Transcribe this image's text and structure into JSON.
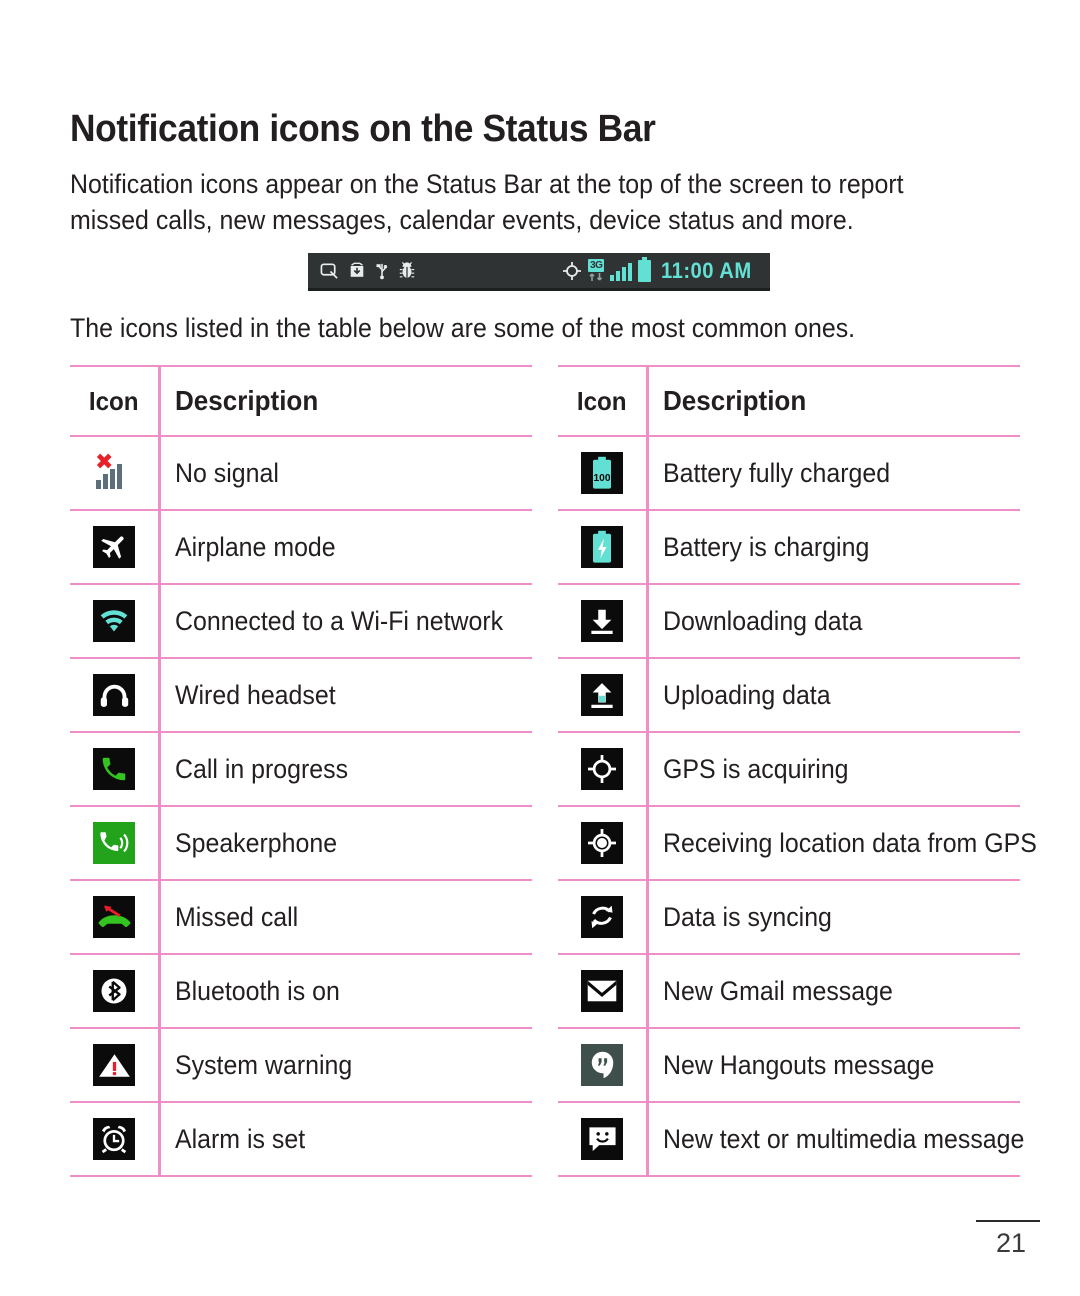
{
  "page": {
    "title": "Notification icons on the Status Bar",
    "intro": "Notification icons appear on the Status Bar at the top of the screen to report missed calls, new messages, calendar events, device status and more.",
    "note": "The icons listed in the table below are some of the most common ones.",
    "page_number": "21"
  },
  "status_bar": {
    "time": "11:00 AM",
    "network_label": "3G",
    "left_icons": [
      "qslide-icon",
      "download-box-icon",
      "usb-icon",
      "bug-icon"
    ],
    "right_icons": [
      "gps-crosshair-icon",
      "3g-data-icon",
      "signal-bars-icon",
      "battery-icon"
    ],
    "background_color": "#2f3334",
    "accent_color": "#63e0d4"
  },
  "colors": {
    "table_rule": "#ef8fc8",
    "tile_background": "#0b0b0b",
    "speakerphone_green": "#23a31c",
    "hangouts_slate": "#3f4f4b",
    "cyan": "#63e0d4",
    "call_green": "#33c41f",
    "red": "#e8202a"
  },
  "tables": [
    {
      "id": "left-table",
      "headers": {
        "icon": "Icon",
        "description": "Description"
      },
      "rows": [
        {
          "icon": "no-signal-icon",
          "description": "No signal"
        },
        {
          "icon": "airplane-mode-icon",
          "description": "Airplane mode"
        },
        {
          "icon": "wifi-connected-icon",
          "description": "Connected to a Wi-Fi network"
        },
        {
          "icon": "wired-headset-icon",
          "description": "Wired headset"
        },
        {
          "icon": "call-in-progress-icon",
          "description": "Call in progress"
        },
        {
          "icon": "speakerphone-icon",
          "description": "Speakerphone"
        },
        {
          "icon": "missed-call-icon",
          "description": "Missed call"
        },
        {
          "icon": "bluetooth-on-icon",
          "description": "Bluetooth is on"
        },
        {
          "icon": "system-warning-icon",
          "description": "System warning"
        },
        {
          "icon": "alarm-set-icon",
          "description": "Alarm is set"
        }
      ]
    },
    {
      "id": "right-table",
      "headers": {
        "icon": "Icon",
        "description": "Description"
      },
      "rows": [
        {
          "icon": "battery-full-icon",
          "description": "Battery fully charged"
        },
        {
          "icon": "battery-charging-icon",
          "description": "Battery is charging"
        },
        {
          "icon": "download-icon",
          "description": "Downloading data"
        },
        {
          "icon": "upload-icon",
          "description": "Uploading data"
        },
        {
          "icon": "gps-acquiring-icon",
          "description": "GPS is acquiring"
        },
        {
          "icon": "gps-receiving-icon",
          "description": "Receiving location data from GPS"
        },
        {
          "icon": "sync-icon",
          "description": "Data is syncing"
        },
        {
          "icon": "gmail-icon",
          "description": "New Gmail message"
        },
        {
          "icon": "hangouts-icon",
          "description": "New Hangouts message"
        },
        {
          "icon": "messaging-icon",
          "description": "New text or multimedia message"
        }
      ]
    }
  ],
  "battery_full_label": "100"
}
